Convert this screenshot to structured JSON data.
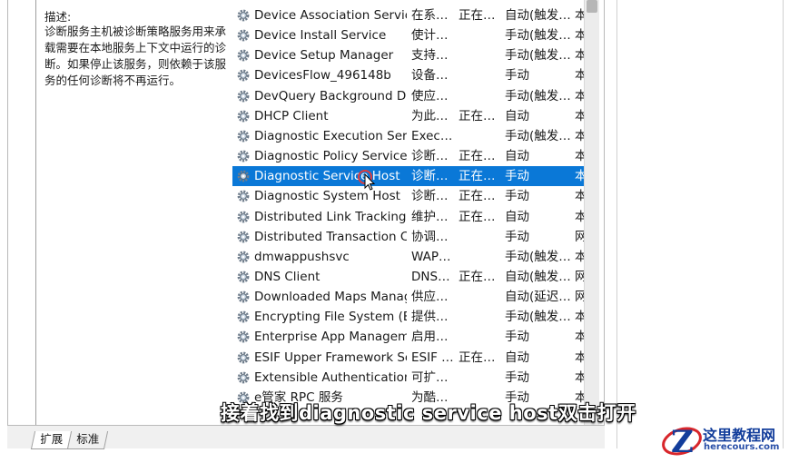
{
  "description": {
    "label": "描述:",
    "text": "诊断服务主机被诊断策略服务用来承载需要在本地服务上下文中运行的诊断。如果停止该服务，则依赖于该服务的任何诊断将不再运行。"
  },
  "services": [
    {
      "name": "Device Association Service",
      "desc": "在系…",
      "status": "正在…",
      "startup": "自动(触发…",
      "logon": "本"
    },
    {
      "name": "Device Install Service",
      "desc": "使计…",
      "status": "",
      "startup": "手动(触发…",
      "logon": "本"
    },
    {
      "name": "Device Setup Manager",
      "desc": "支持…",
      "status": "",
      "startup": "手动(触发…",
      "logon": "本"
    },
    {
      "name": "DevicesFlow_496148b",
      "desc": "设备…",
      "status": "",
      "startup": "手动",
      "logon": "本"
    },
    {
      "name": "DevQuery Background Dis…",
      "desc": "使应…",
      "status": "",
      "startup": "手动(触发…",
      "logon": "本"
    },
    {
      "name": "DHCP Client",
      "desc": "为此…",
      "status": "正在…",
      "startup": "自动",
      "logon": "本"
    },
    {
      "name": "Diagnostic Execution Service",
      "desc": "Exec…",
      "status": "",
      "startup": "手动(触发…",
      "logon": "本"
    },
    {
      "name": "Diagnostic Policy Service",
      "desc": "诊断…",
      "status": "正在…",
      "startup": "自动",
      "logon": "本"
    },
    {
      "name": "Diagnostic Service Host",
      "desc": "诊断…",
      "status": "正在…",
      "startup": "手动",
      "logon": "本",
      "selected": true
    },
    {
      "name": "Diagnostic System Host",
      "desc": "诊断…",
      "status": "正在…",
      "startup": "手动",
      "logon": "本"
    },
    {
      "name": "Distributed Link Tracking C…",
      "desc": "维护…",
      "status": "正在…",
      "startup": "自动",
      "logon": "本"
    },
    {
      "name": "Distributed Transaction Co…",
      "desc": "协调…",
      "status": "",
      "startup": "手动",
      "logon": "网"
    },
    {
      "name": "dmwappushsvc",
      "desc": "WAP…",
      "status": "",
      "startup": "手动(触发…",
      "logon": "本"
    },
    {
      "name": "DNS Client",
      "desc": "DNS…",
      "status": "正在…",
      "startup": "自动(触发…",
      "logon": "网"
    },
    {
      "name": "Downloaded Maps Manager",
      "desc": "供应…",
      "status": "",
      "startup": "自动(延迟…",
      "logon": "网"
    },
    {
      "name": "Encrypting File System (EFS)",
      "desc": "提供…",
      "status": "",
      "startup": "手动(触发…",
      "logon": "本"
    },
    {
      "name": "Enterprise App Manageme…",
      "desc": "启用…",
      "status": "",
      "startup": "手动",
      "logon": "本"
    },
    {
      "name": "ESIF Upper Framework Ser…",
      "desc": "ESIF …",
      "status": "正在…",
      "startup": "自动",
      "logon": "本"
    },
    {
      "name": "Extensible Authentication …",
      "desc": "可扩…",
      "status": "",
      "startup": "手动",
      "logon": "本"
    },
    {
      "name": "e管家 RPC 服务",
      "desc": "为酷…",
      "status": "",
      "startup": "手动",
      "logon": "本"
    }
  ],
  "tabs": [
    {
      "label": "扩展"
    },
    {
      "label": "标准"
    }
  ],
  "subtitle": "接着找到diagnostic service host双击打开",
  "watermark": {
    "name": "这里教程网",
    "url": "herecours.com"
  },
  "colors": {
    "selection": "#0a78d7",
    "logo_blue": "#123d9b",
    "logo_red": "#d8262b"
  }
}
